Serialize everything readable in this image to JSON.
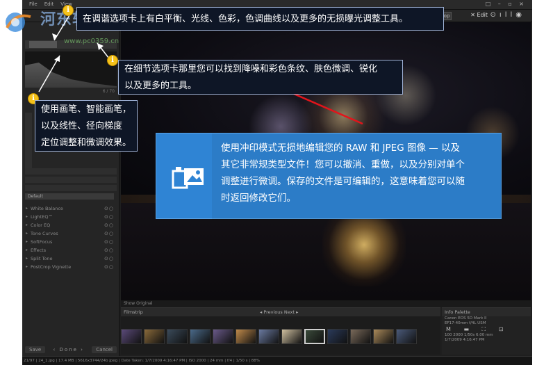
{
  "app": {
    "menu": [
      "File",
      "Edit",
      "View"
    ],
    "window_controls": "□ – ▫ ×",
    "toolbar": {
      "develop": "Develop",
      "edit": "Edit"
    }
  },
  "left_panel": {
    "hist_label": "6 / 70",
    "selected_row": "Default",
    "sections": [
      {
        "label": "White Balance"
      },
      {
        "label": "LightEQ™"
      },
      {
        "label": "Color EQ"
      },
      {
        "label": "Tone Curves"
      },
      {
        "label": "SoftFocus"
      },
      {
        "label": "Effects"
      },
      {
        "label": "Split Tone"
      },
      {
        "label": "PostCrop Vignette"
      }
    ],
    "save_label": "Save",
    "done_label": "Done",
    "cancel_label": "Cancel"
  },
  "canvas_status": "Show Original",
  "filmstrip": {
    "title": "Filmstrip",
    "nav": "◂ Previous   Next ▸",
    "thumb_colors": [
      "#5b4a7a",
      "#8a6a3a",
      "#3a4a5a",
      "#4a6a8a",
      "#6a5a8a",
      "#c08a4a",
      "#6a7aa0",
      "#d0c0a0",
      "#3a4a3a",
      "#2a3a5a",
      "#7a6a5a",
      "#aa8a5a",
      "#4a5a7a",
      "#c0a070",
      "#6a4a8a",
      "#e0e0e0"
    ],
    "selected_index": 8
  },
  "info_palette": {
    "title": "Info Palette",
    "lines": [
      "Canon EOS 5D Mark II",
      "EF17-40mm f/4L USM",
      "M   ▬   ⛶   ⊡",
      "100 2000   1/50s   6.00 mm",
      "1/7/2009 4:16:47 PM"
    ]
  },
  "statusbar": "21/97 | 24_1.jpg | 17.4 MB | 5616x3744/24b jpeg | Date Taken: 1/7/2009 4:16:47 PM | ISO 2000 | 24 mm | f/4 | 1/50 s | 88%",
  "watermark": {
    "cn": "河东软件园",
    "url": "www.pc0359.cn"
  },
  "callouts": {
    "tune": "在调谐选项卡上有白平衡、光线、色彩，色调曲线以及更多的无损曝光调整工具。",
    "detail_line1": "在细节选项卡那里您可以找到降噪和彩色条纹、肤色微调、锐化",
    "detail_line2": "以及更多的工具。",
    "brush_line1": "使用画笔、智能画笔，",
    "brush_line2": "以及线性、径向梯度",
    "brush_line3": "定位调整和微调效果。",
    "marker_glyph": "i",
    "develop_line1": "使用冲印模式无损地编辑您的 RAW 和 JPEG 图像 — 以及",
    "develop_line2": "其它非常规类型文件！您可以撤消、重做，以及分别对单个",
    "develop_line3": "调整进行微调。保存的文件是可编辑的，这意味着您可以随",
    "develop_line4": "时返回修改它们。"
  },
  "colors": {
    "callout_bg": "#0e1626",
    "callout_border": "#9fb2d6",
    "marker": "#f5c21b",
    "big_panel": "#2f84d4",
    "arrow": "#e2141b"
  }
}
